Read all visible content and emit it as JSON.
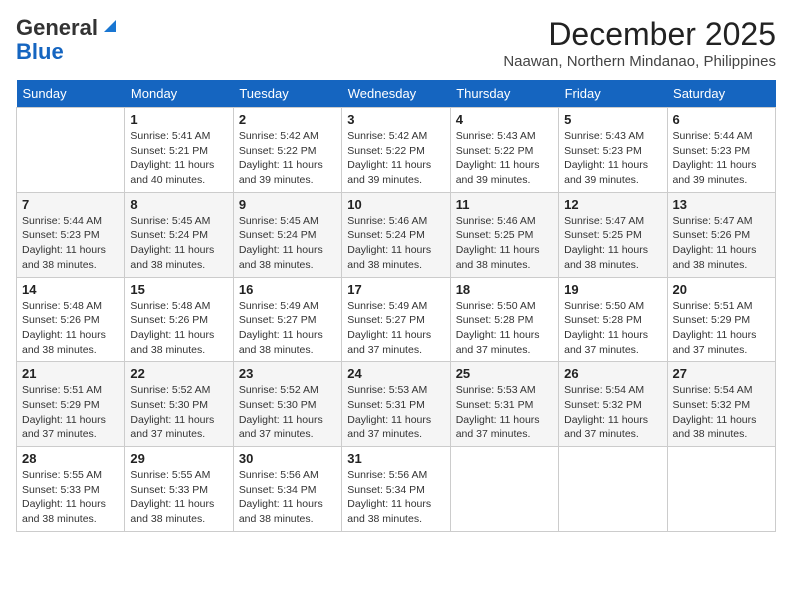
{
  "header": {
    "logo_line1": "General",
    "logo_line2": "Blue",
    "month": "December 2025",
    "location": "Naawan, Northern Mindanao, Philippines"
  },
  "weekdays": [
    "Sunday",
    "Monday",
    "Tuesday",
    "Wednesday",
    "Thursday",
    "Friday",
    "Saturday"
  ],
  "weeks": [
    [
      {
        "day": "",
        "sunrise": "",
        "sunset": "",
        "daylight": ""
      },
      {
        "day": "1",
        "sunrise": "Sunrise: 5:41 AM",
        "sunset": "Sunset: 5:21 PM",
        "daylight": "Daylight: 11 hours and 40 minutes."
      },
      {
        "day": "2",
        "sunrise": "Sunrise: 5:42 AM",
        "sunset": "Sunset: 5:22 PM",
        "daylight": "Daylight: 11 hours and 39 minutes."
      },
      {
        "day": "3",
        "sunrise": "Sunrise: 5:42 AM",
        "sunset": "Sunset: 5:22 PM",
        "daylight": "Daylight: 11 hours and 39 minutes."
      },
      {
        "day": "4",
        "sunrise": "Sunrise: 5:43 AM",
        "sunset": "Sunset: 5:22 PM",
        "daylight": "Daylight: 11 hours and 39 minutes."
      },
      {
        "day": "5",
        "sunrise": "Sunrise: 5:43 AM",
        "sunset": "Sunset: 5:23 PM",
        "daylight": "Daylight: 11 hours and 39 minutes."
      },
      {
        "day": "6",
        "sunrise": "Sunrise: 5:44 AM",
        "sunset": "Sunset: 5:23 PM",
        "daylight": "Daylight: 11 hours and 39 minutes."
      }
    ],
    [
      {
        "day": "7",
        "sunrise": "Sunrise: 5:44 AM",
        "sunset": "Sunset: 5:23 PM",
        "daylight": "Daylight: 11 hours and 38 minutes."
      },
      {
        "day": "8",
        "sunrise": "Sunrise: 5:45 AM",
        "sunset": "Sunset: 5:24 PM",
        "daylight": "Daylight: 11 hours and 38 minutes."
      },
      {
        "day": "9",
        "sunrise": "Sunrise: 5:45 AM",
        "sunset": "Sunset: 5:24 PM",
        "daylight": "Daylight: 11 hours and 38 minutes."
      },
      {
        "day": "10",
        "sunrise": "Sunrise: 5:46 AM",
        "sunset": "Sunset: 5:24 PM",
        "daylight": "Daylight: 11 hours and 38 minutes."
      },
      {
        "day": "11",
        "sunrise": "Sunrise: 5:46 AM",
        "sunset": "Sunset: 5:25 PM",
        "daylight": "Daylight: 11 hours and 38 minutes."
      },
      {
        "day": "12",
        "sunrise": "Sunrise: 5:47 AM",
        "sunset": "Sunset: 5:25 PM",
        "daylight": "Daylight: 11 hours and 38 minutes."
      },
      {
        "day": "13",
        "sunrise": "Sunrise: 5:47 AM",
        "sunset": "Sunset: 5:26 PM",
        "daylight": "Daylight: 11 hours and 38 minutes."
      }
    ],
    [
      {
        "day": "14",
        "sunrise": "Sunrise: 5:48 AM",
        "sunset": "Sunset: 5:26 PM",
        "daylight": "Daylight: 11 hours and 38 minutes."
      },
      {
        "day": "15",
        "sunrise": "Sunrise: 5:48 AM",
        "sunset": "Sunset: 5:26 PM",
        "daylight": "Daylight: 11 hours and 38 minutes."
      },
      {
        "day": "16",
        "sunrise": "Sunrise: 5:49 AM",
        "sunset": "Sunset: 5:27 PM",
        "daylight": "Daylight: 11 hours and 38 minutes."
      },
      {
        "day": "17",
        "sunrise": "Sunrise: 5:49 AM",
        "sunset": "Sunset: 5:27 PM",
        "daylight": "Daylight: 11 hours and 37 minutes."
      },
      {
        "day": "18",
        "sunrise": "Sunrise: 5:50 AM",
        "sunset": "Sunset: 5:28 PM",
        "daylight": "Daylight: 11 hours and 37 minutes."
      },
      {
        "day": "19",
        "sunrise": "Sunrise: 5:50 AM",
        "sunset": "Sunset: 5:28 PM",
        "daylight": "Daylight: 11 hours and 37 minutes."
      },
      {
        "day": "20",
        "sunrise": "Sunrise: 5:51 AM",
        "sunset": "Sunset: 5:29 PM",
        "daylight": "Daylight: 11 hours and 37 minutes."
      }
    ],
    [
      {
        "day": "21",
        "sunrise": "Sunrise: 5:51 AM",
        "sunset": "Sunset: 5:29 PM",
        "daylight": "Daylight: 11 hours and 37 minutes."
      },
      {
        "day": "22",
        "sunrise": "Sunrise: 5:52 AM",
        "sunset": "Sunset: 5:30 PM",
        "daylight": "Daylight: 11 hours and 37 minutes."
      },
      {
        "day": "23",
        "sunrise": "Sunrise: 5:52 AM",
        "sunset": "Sunset: 5:30 PM",
        "daylight": "Daylight: 11 hours and 37 minutes."
      },
      {
        "day": "24",
        "sunrise": "Sunrise: 5:53 AM",
        "sunset": "Sunset: 5:31 PM",
        "daylight": "Daylight: 11 hours and 37 minutes."
      },
      {
        "day": "25",
        "sunrise": "Sunrise: 5:53 AM",
        "sunset": "Sunset: 5:31 PM",
        "daylight": "Daylight: 11 hours and 37 minutes."
      },
      {
        "day": "26",
        "sunrise": "Sunrise: 5:54 AM",
        "sunset": "Sunset: 5:32 PM",
        "daylight": "Daylight: 11 hours and 37 minutes."
      },
      {
        "day": "27",
        "sunrise": "Sunrise: 5:54 AM",
        "sunset": "Sunset: 5:32 PM",
        "daylight": "Daylight: 11 hours and 38 minutes."
      }
    ],
    [
      {
        "day": "28",
        "sunrise": "Sunrise: 5:55 AM",
        "sunset": "Sunset: 5:33 PM",
        "daylight": "Daylight: 11 hours and 38 minutes."
      },
      {
        "day": "29",
        "sunrise": "Sunrise: 5:55 AM",
        "sunset": "Sunset: 5:33 PM",
        "daylight": "Daylight: 11 hours and 38 minutes."
      },
      {
        "day": "30",
        "sunrise": "Sunrise: 5:56 AM",
        "sunset": "Sunset: 5:34 PM",
        "daylight": "Daylight: 11 hours and 38 minutes."
      },
      {
        "day": "31",
        "sunrise": "Sunrise: 5:56 AM",
        "sunset": "Sunset: 5:34 PM",
        "daylight": "Daylight: 11 hours and 38 minutes."
      },
      {
        "day": "",
        "sunrise": "",
        "sunset": "",
        "daylight": ""
      },
      {
        "day": "",
        "sunrise": "",
        "sunset": "",
        "daylight": ""
      },
      {
        "day": "",
        "sunrise": "",
        "sunset": "",
        "daylight": ""
      }
    ]
  ]
}
